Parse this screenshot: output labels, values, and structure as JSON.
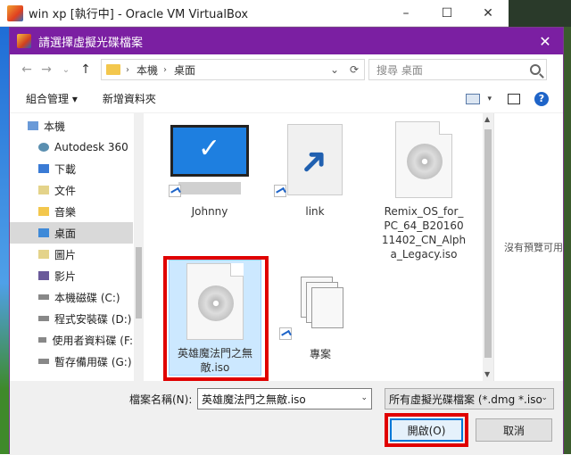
{
  "vbox": {
    "title": "win xp [執行中] - Oracle VM VirtualBox",
    "minimize": "–",
    "maximize": "☐",
    "close": "✕"
  },
  "dialog": {
    "title": "請選擇虛擬光碟檔案",
    "close": "✕"
  },
  "address": {
    "back": "←",
    "forward": "→",
    "dropdown": "⌄",
    "up": "↑",
    "crumbs": [
      "本機",
      "桌面"
    ],
    "crumb_sep": "›",
    "dropdown2": "⌄",
    "refresh": "⟳",
    "search_placeholder": "搜尋 桌面"
  },
  "toolbar": {
    "organize": "組合管理 ▾",
    "new_folder": "新增資料夾",
    "view_caret": "▾",
    "help": "?"
  },
  "nav": {
    "items": [
      {
        "label": "本機",
        "icon": "computer-icon"
      },
      {
        "label": "Autodesk 360",
        "icon": "cloud-icon"
      },
      {
        "label": "下載",
        "icon": "download-icon"
      },
      {
        "label": "文件",
        "icon": "document-icon"
      },
      {
        "label": "音樂",
        "icon": "music-icon"
      },
      {
        "label": "桌面",
        "icon": "desktop-icon"
      },
      {
        "label": "圖片",
        "icon": "picture-icon"
      },
      {
        "label": "影片",
        "icon": "video-icon"
      },
      {
        "label": "本機磁碟 (C:)",
        "icon": "drive-icon"
      },
      {
        "label": "程式安裝碟 (D:)",
        "icon": "drive-icon"
      },
      {
        "label": "使用者資料碟 (F:",
        "icon": "drive-icon"
      },
      {
        "label": "暫存備用碟 (G:)",
        "icon": "drive-icon"
      }
    ]
  },
  "files": [
    {
      "label": "Johnny",
      "icon": "computer-shortcut-icon"
    },
    {
      "label": "link",
      "icon": "shortcut-icon"
    },
    {
      "label": "Remix_OS_for_PC_64_B2016011402_CN_Alpha_Legacy.iso",
      "icon": "disc-image-icon"
    },
    {
      "label": "英雄魔法門之無敵.iso",
      "icon": "disc-image-icon"
    },
    {
      "label": "專案",
      "icon": "folder-stack-icon"
    }
  ],
  "preview": {
    "text": "沒有預覽可用"
  },
  "filename": {
    "label": "檔案名稱(N):",
    "value": "英雄魔法門之無敵.iso",
    "dropdown": "⌄"
  },
  "filetype": {
    "value": "所有虛擬光碟檔案 (*.dmg *.iso",
    "dropdown": "⌄"
  },
  "buttons": {
    "open": "開啟(O)",
    "cancel": "取消"
  },
  "scroll": {
    "up": "▲",
    "down": "▼"
  },
  "colors": {
    "dialog_title": "#7b1fa2",
    "highlight": "#e00000",
    "selection": "#cce8ff",
    "accent": "#0078d7"
  }
}
